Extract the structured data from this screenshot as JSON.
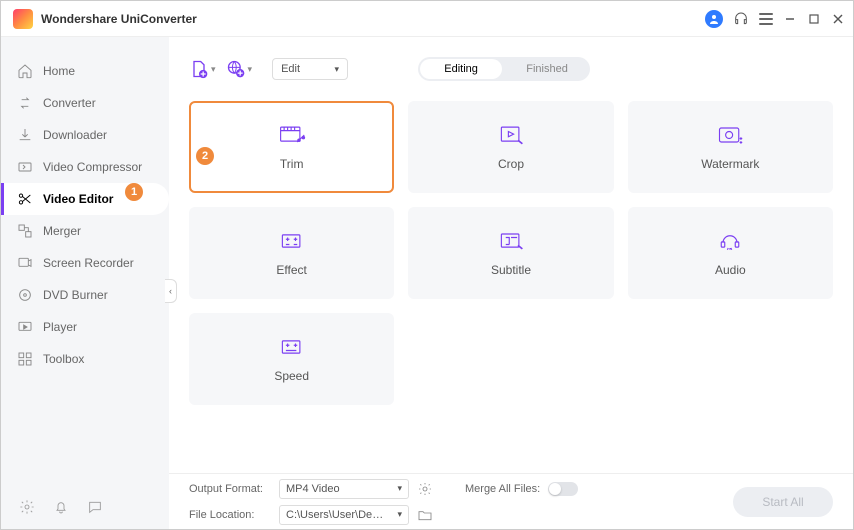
{
  "app_title": "Wondershare UniConverter",
  "sidebar": {
    "items": [
      {
        "label": "Home"
      },
      {
        "label": "Converter"
      },
      {
        "label": "Downloader"
      },
      {
        "label": "Video Compressor"
      },
      {
        "label": "Video Editor"
      },
      {
        "label": "Merger"
      },
      {
        "label": "Screen Recorder"
      },
      {
        "label": "DVD Burner"
      },
      {
        "label": "Player"
      },
      {
        "label": "Toolbox"
      }
    ]
  },
  "toolbar": {
    "edit_dropdown": "Edit",
    "tabs": {
      "editing": "Editing",
      "finished": "Finished"
    }
  },
  "editor_tiles": {
    "trim": "Trim",
    "crop": "Crop",
    "watermark": "Watermark",
    "effect": "Effect",
    "subtitle": "Subtitle",
    "audio": "Audio",
    "speed": "Speed"
  },
  "footer": {
    "output_format_label": "Output Format:",
    "output_format_value": "MP4 Video",
    "file_location_label": "File Location:",
    "file_location_value": "C:\\Users\\User\\Desktop",
    "merge_label": "Merge All Files:",
    "start_label": "Start All"
  },
  "annotations": {
    "b1": "1",
    "b2": "2"
  }
}
